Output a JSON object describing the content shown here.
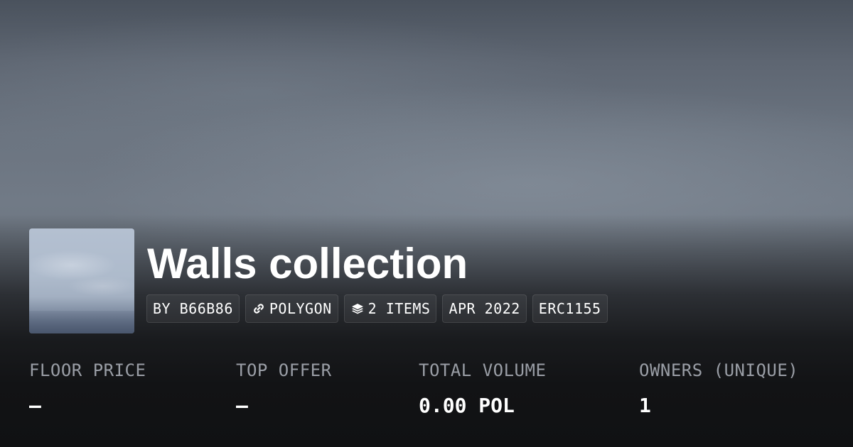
{
  "collection": {
    "title": "Walls collection",
    "thumbnail_icon": "sky-thumbnail"
  },
  "tags": [
    {
      "label": "BY B66B86",
      "icon": null
    },
    {
      "label": "POLYGON",
      "icon": "link-icon"
    },
    {
      "label": "2 ITEMS",
      "icon": "layers-icon"
    },
    {
      "label": "APR 2022",
      "icon": null
    },
    {
      "label": "ERC1155",
      "icon": null
    }
  ],
  "stats": {
    "floor_price": {
      "label": "FLOOR PRICE",
      "value": "–"
    },
    "top_offer": {
      "label": "TOP OFFER",
      "value": "–"
    },
    "total_volume": {
      "label": "TOTAL VOLUME",
      "value": "0.00 POL"
    },
    "owners": {
      "label": "OWNERS (UNIQUE)",
      "value": "1"
    }
  },
  "colors": {
    "text": "#ffffff",
    "label": "#9a9ea6",
    "background_bottom": "#121315"
  }
}
